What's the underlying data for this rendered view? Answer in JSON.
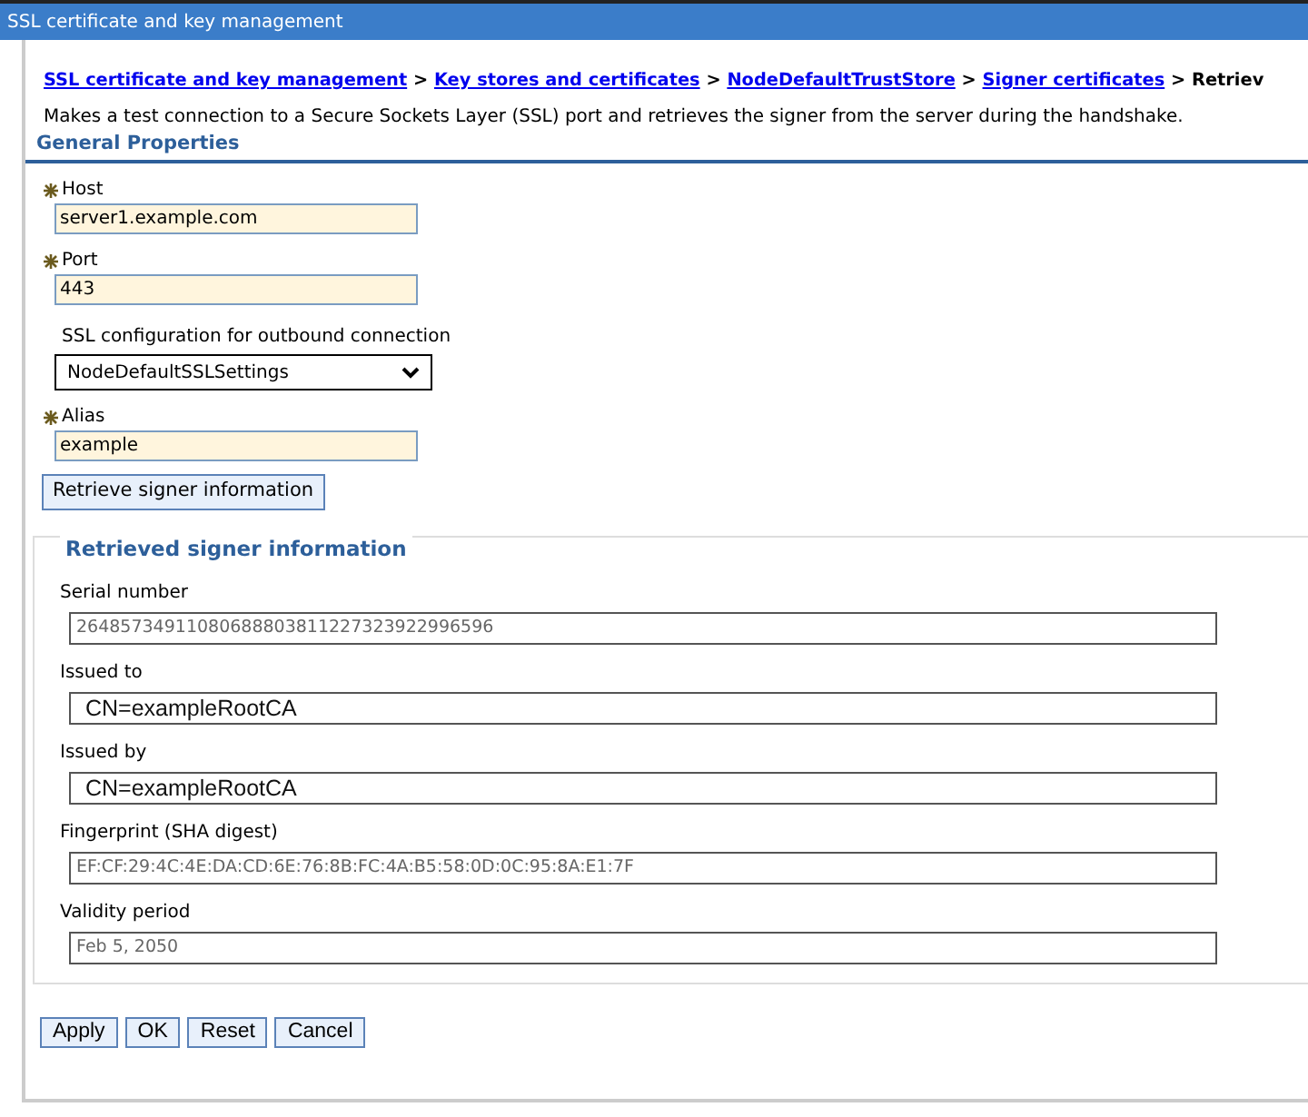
{
  "window": {
    "title": "SSL certificate and key management"
  },
  "breadcrumb": {
    "links": [
      "SSL certificate and key management",
      "Key stores and certificates",
      "NodeDefaultTrustStore",
      "Signer certificates"
    ],
    "separators": [
      ">",
      ">",
      ">",
      ">"
    ],
    "current": "Retriev"
  },
  "description": "Makes a test connection to a Secure Sockets Layer (SSL) port and retrieves the signer from the server during the handshake.",
  "section_title": "General Properties",
  "fields": [
    {
      "kind": "text",
      "label": "Host",
      "required": true,
      "value": "server1.example.com"
    },
    {
      "kind": "text",
      "label": "Port",
      "required": true,
      "value": "443"
    },
    {
      "kind": "select",
      "label": "SSL configuration for outbound connection",
      "required": false,
      "value": "NodeDefaultSSLSettings"
    },
    {
      "kind": "text",
      "label": "Alias",
      "required": true,
      "value": "example"
    }
  ],
  "retrieve_button": "Retrieve signer information",
  "signer": {
    "title": "Retrieved signer information",
    "fields": [
      {
        "kind": "readonly",
        "label": "Serial number",
        "value": "26485734911080688803811227323922996596"
      },
      {
        "kind": "dn",
        "label": "Issued to",
        "value": "CN=exampleRootCA"
      },
      {
        "kind": "dn",
        "label": "Issued by",
        "value": "CN=exampleRootCA"
      },
      {
        "kind": "readonly",
        "label": "Fingerprint (SHA digest)",
        "value": "EF:CF:29:4C:4E:DA:CD:6E:76:8B:FC:4A:B5:58:0D:0C:95:8A:E1:7F"
      },
      {
        "kind": "readonly",
        "label": "Validity period",
        "value": "Feb 5, 2050"
      }
    ]
  },
  "buttons": [
    "Apply",
    "OK",
    "Reset",
    "Cancel"
  ]
}
